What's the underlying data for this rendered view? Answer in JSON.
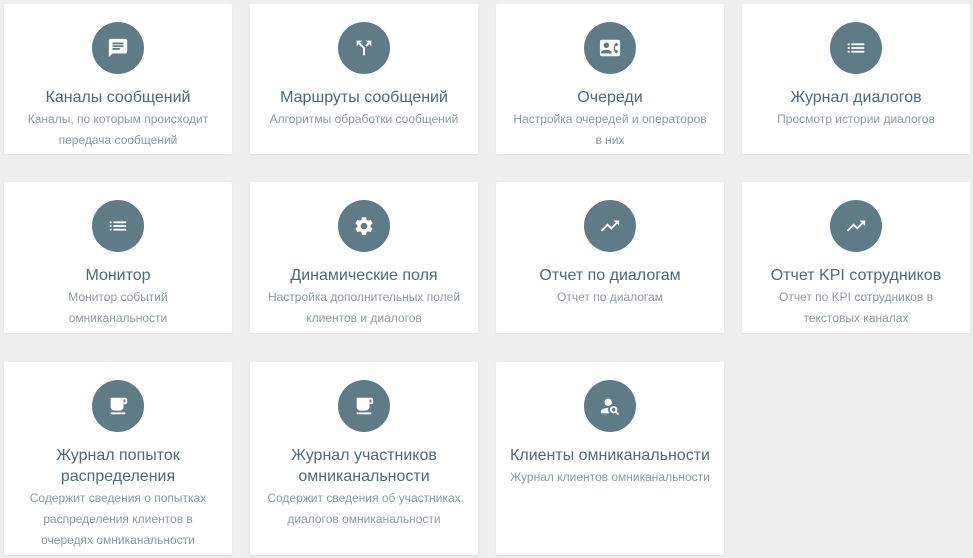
{
  "colors": {
    "background": "#eeeeee",
    "card": "#ffffff",
    "icon_bg": "#5f7b86",
    "title": "#4d6a76",
    "description": "#8a9aa0"
  },
  "cards": [
    {
      "title": "Каналы сообщений",
      "description": "Каналы, по которым происходит передача сообщений",
      "icon": "message-icon"
    },
    {
      "title": "Маршруты сообщений",
      "description": "Алгоритмы обработки сообщений",
      "icon": "route-split-icon"
    },
    {
      "title": "Очереди",
      "description": "Настройка очередей и операторов в них",
      "icon": "contact-card-icon"
    },
    {
      "title": "Журнал диалогов",
      "description": "Просмотр истории диалогов",
      "icon": "list-icon"
    },
    {
      "title": "Монитор",
      "description": "Монитор событий омниканальности",
      "icon": "list-icon"
    },
    {
      "title": "Динамические поля",
      "description": "Настройка дополнительных полей клиентов и диалогов",
      "icon": "gear-icon"
    },
    {
      "title": "Отчет по диалогам",
      "description": "Отчет по диалогам",
      "icon": "trending-up-icon"
    },
    {
      "title": "Отчет KPI сотрудников",
      "description": "Отчет по KPI сотрудников в текстовых каналах",
      "icon": "trending-up-icon"
    },
    {
      "title": "Журнал попыток распределения",
      "description": "Содержит сведения о попытках распределения клиентов в очередях омниканальности",
      "icon": "coffee-cup-icon"
    },
    {
      "title": "Журнал участников омниканальности",
      "description": "Содержит сведения об участниках диалогов омниканальности",
      "icon": "coffee-cup-icon"
    },
    {
      "title": "Клиенты омниканальности",
      "description": "Журнал клиентов омниканальности",
      "icon": "person-search-icon"
    }
  ]
}
